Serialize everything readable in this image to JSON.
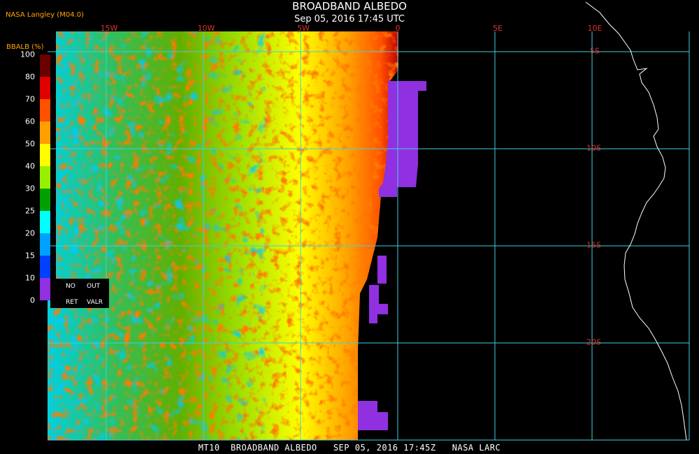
{
  "header": {
    "title": "BROADBAND ALBEDO",
    "subtitle": "Sep 05, 2016 17:45 UTC",
    "producer": "NASA Langley (M04.0)"
  },
  "footer": {
    "text": "MT10  BROADBAND ALBEDO   SEP 05, 2016 17:45Z   NASA LARC"
  },
  "map": {
    "longitude_labels": [
      "15W",
      "10W",
      "5W",
      "0",
      "5E",
      "10E"
    ],
    "latitude_labels": [
      "5S",
      "10S",
      "15S",
      "20S"
    ],
    "grid_color": "#40d0e0",
    "coastline_color": "#ffffff",
    "nodata_color": "#9030e0"
  },
  "legend": {
    "title": "BBALB (%)",
    "ticks": [
      "100",
      "80",
      "70",
      "60",
      "50",
      "40",
      "30",
      "25",
      "20",
      "15",
      "10",
      "0"
    ],
    "colors": [
      "#6a0000",
      "#e00000",
      "#ff5000",
      "#ffa000",
      "#ffff00",
      "#98f000",
      "#00a000",
      "#00ffff",
      "#00a0ff",
      "#0040ff",
      "#0000c0",
      "#9030e0"
    ],
    "no_ret": [
      "NO",
      "RET"
    ],
    "out_valr": [
      "OUT",
      "VALR"
    ]
  }
}
